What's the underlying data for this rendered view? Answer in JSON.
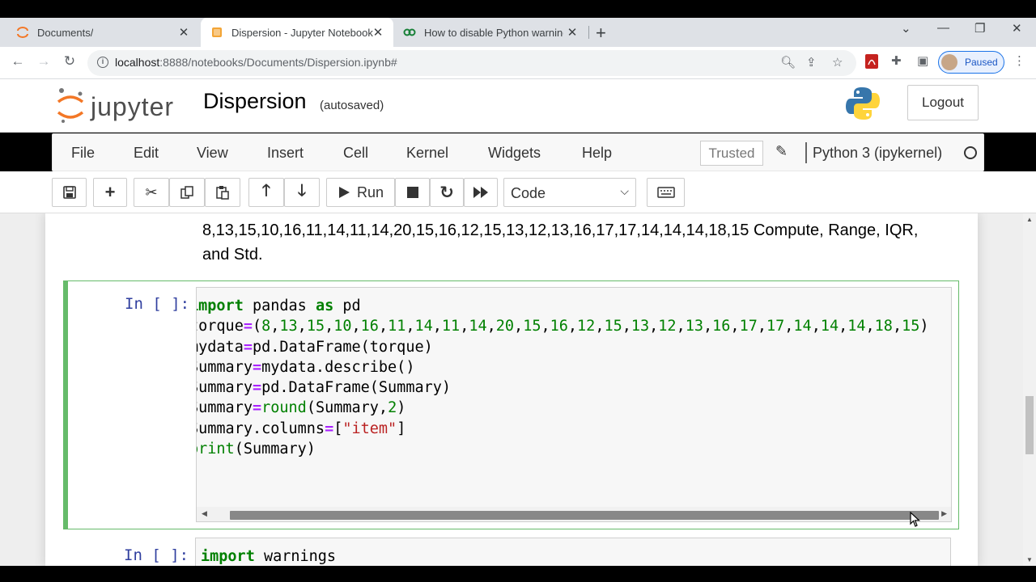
{
  "browser": {
    "tabs": [
      {
        "title": "Documents/",
        "active": false
      },
      {
        "title": "Dispersion - Jupyter Notebook",
        "active": true
      },
      {
        "title": "How to disable Python warnings?",
        "active": false
      }
    ],
    "url_host": "localhost",
    "url_path": ":8888/notebooks/Documents/Dispersion.ipynb#",
    "profile_label": "Paused"
  },
  "jupyter": {
    "logo_text": "jupyter",
    "notebook_title": "Dispersion",
    "autosave_status": "(autosaved)",
    "logout_label": "Logout",
    "menu": [
      "File",
      "Edit",
      "View",
      "Insert",
      "Cell",
      "Kernel",
      "Widgets",
      "Help"
    ],
    "trusted_label": "Trusted",
    "kernel_name": "Python 3 (ipykernel)",
    "toolbar": {
      "run_label": "Run",
      "cell_type": "Code"
    }
  },
  "notebook": {
    "markdown_text": "8,13,15,10,16,11,14,11,14,20,15,16,12,15,13,12,13,16,17,17,14,14,14,18,15 Compute, Range, IQR, and Std.",
    "cells": [
      {
        "prompt": "In [ ]:"
      },
      {
        "prompt": "In [ ]:"
      }
    ]
  },
  "colors": {
    "selected_cell_border": "#66bb6a",
    "prompt": "#303f9f",
    "keyword": "#008000",
    "operator": "#aa22ff",
    "string": "#ba2121"
  }
}
